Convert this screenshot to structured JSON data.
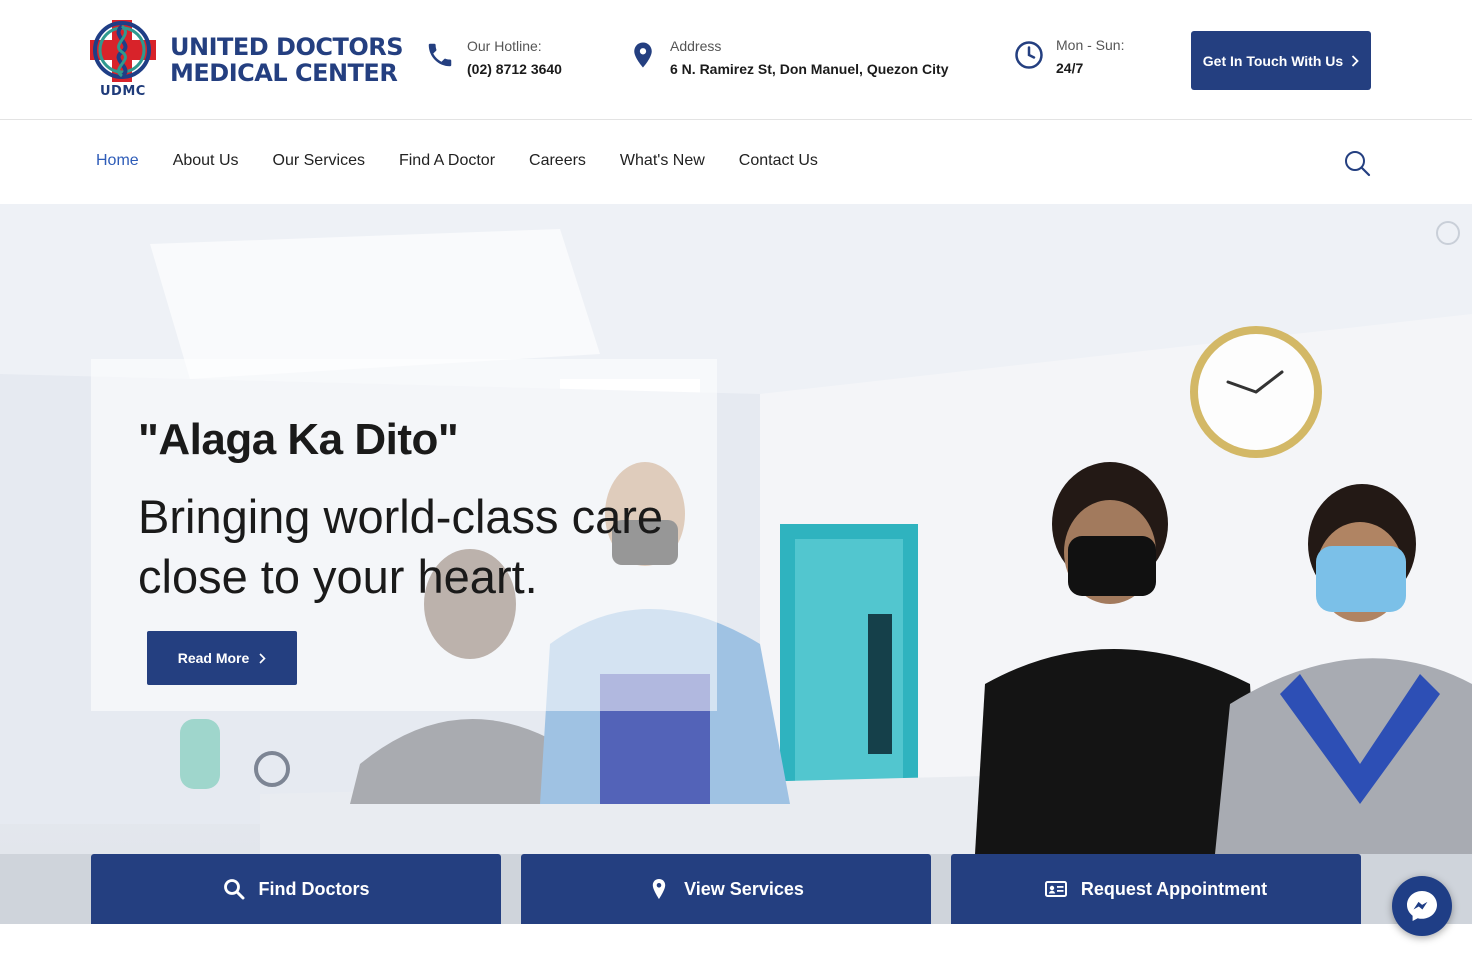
{
  "brand": {
    "abbr": "UDMC",
    "name_line1": "UNITED DOCTORS",
    "name_line2": "MEDICAL CENTER",
    "primary_color": "#243f80",
    "cross_color": "#d8232a"
  },
  "header": {
    "hotline": {
      "label": "Our Hotline:",
      "value": "(02) 8712 3640",
      "icon": "phone-icon"
    },
    "address": {
      "label": "Address",
      "value": "6 N. Ramirez St, Don Manuel, Quezon City",
      "icon": "map-pin-icon"
    },
    "hours": {
      "label": "Mon - Sun:",
      "value": "24/7",
      "icon": "clock-icon"
    },
    "cta_label": "Get In Touch With Us"
  },
  "nav": {
    "items": [
      {
        "label": "Home",
        "active": true
      },
      {
        "label": "About Us"
      },
      {
        "label": "Our Services"
      },
      {
        "label": "Find A Doctor"
      },
      {
        "label": "Careers"
      },
      {
        "label": "What's New"
      },
      {
        "label": "Contact Us"
      }
    ],
    "search_icon": "search-icon",
    "active_color": "#2e5cb8"
  },
  "hero": {
    "title": "\"Alaga Ka Dito\"",
    "subtitle": "Bringing world-class care close to your heart.",
    "button_label": "Read More"
  },
  "quick_actions": {
    "find_doctors": "Find Doctors",
    "view_services": "View Services",
    "request_appointment": "Request Appointment"
  }
}
